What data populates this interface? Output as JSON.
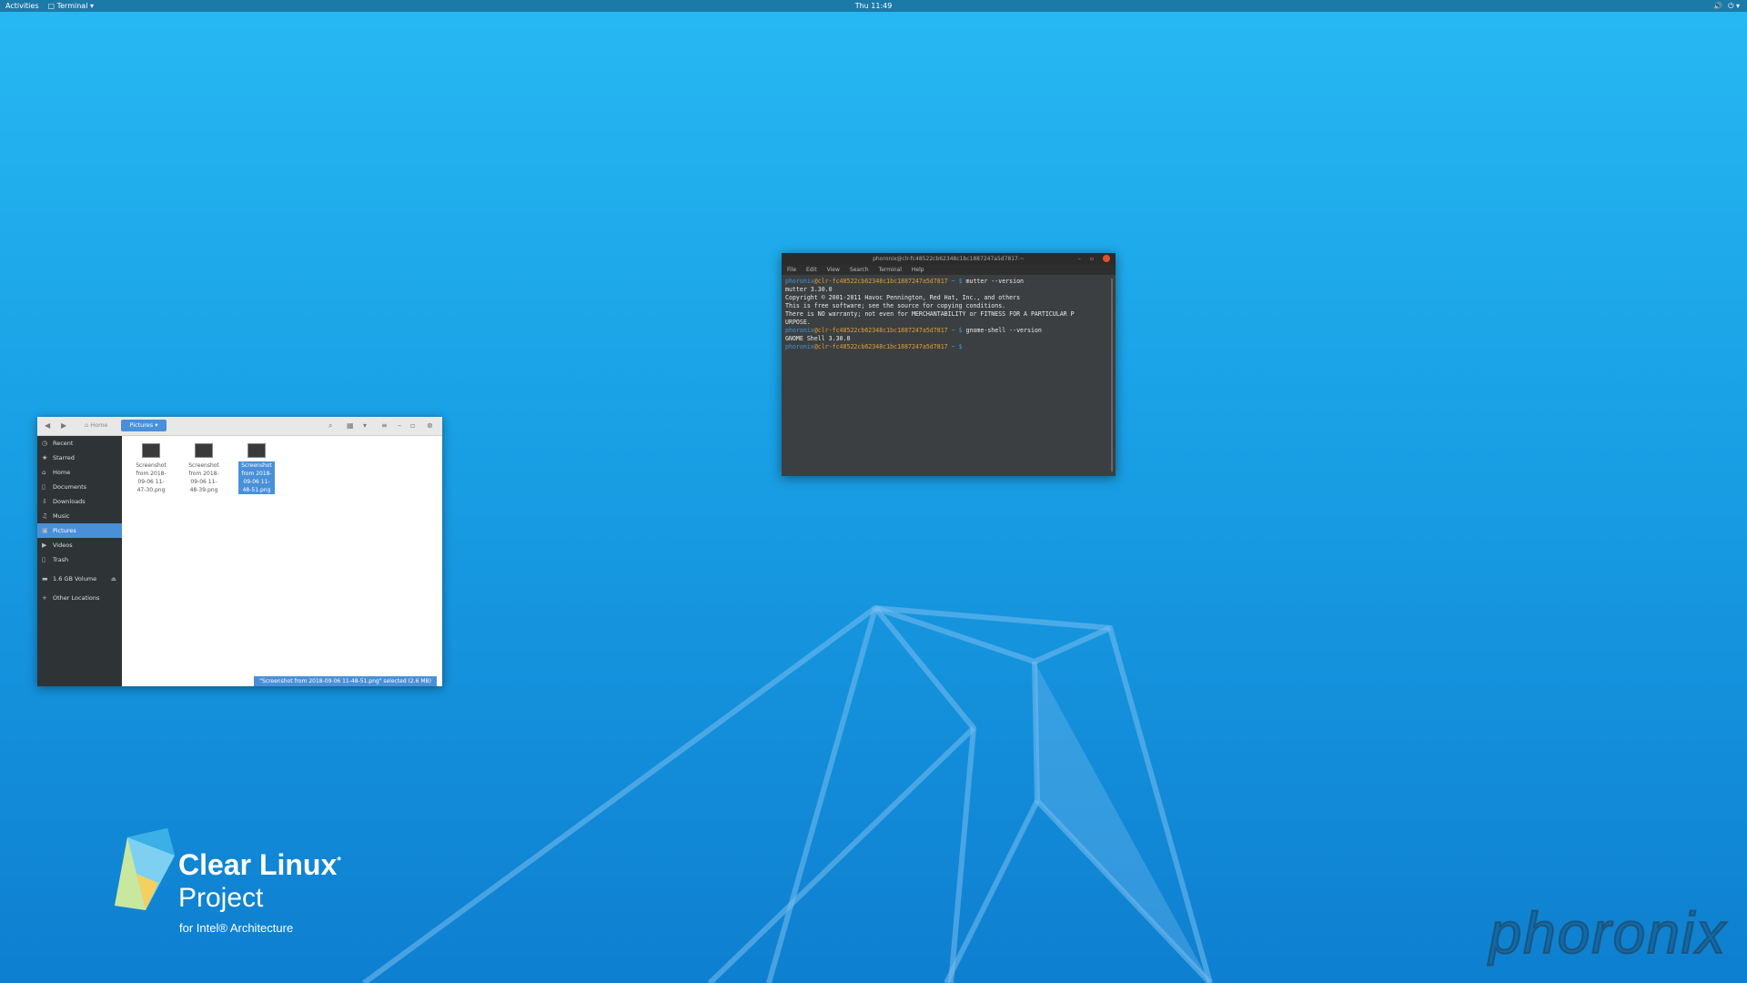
{
  "topbar": {
    "activities": "Activities",
    "app_menu": "Terminal",
    "clock": "Thu 11:49"
  },
  "files": {
    "home_crumb": "Home",
    "current_folder": "Pictures",
    "sidebar": [
      {
        "label": "Recent",
        "icon": "clock-icon"
      },
      {
        "label": "Starred",
        "icon": "star-icon"
      },
      {
        "label": "Home",
        "icon": "home-icon"
      },
      {
        "label": "Documents",
        "icon": "document-icon"
      },
      {
        "label": "Downloads",
        "icon": "download-icon"
      },
      {
        "label": "Music",
        "icon": "music-icon"
      },
      {
        "label": "Pictures",
        "icon": "picture-icon",
        "selected": true
      },
      {
        "label": "Videos",
        "icon": "video-icon"
      },
      {
        "label": "Trash",
        "icon": "trash-icon"
      }
    ],
    "volume": "1.6 GB Volume",
    "other_locations": "Other Locations",
    "files": [
      {
        "line1": "Screenshot",
        "line2": "from 2018-",
        "line3": "09-06 11-",
        "line4": "47-30.png"
      },
      {
        "line1": "Screenshot",
        "line2": "from 2018-",
        "line3": "09-06 11-",
        "line4": "48-39.png"
      },
      {
        "line1": "Screenshot",
        "line2": "from 2018-",
        "line3": "09-06 11-",
        "line4": "48-51.png",
        "selected": true
      }
    ],
    "status": "\"Screenshot from 2018-09-06 11-48-51.png\" selected (2.6 MB)"
  },
  "terminal": {
    "title": "phoronix@clr-fc48522cb62348c1bc1887247a5d7817:~",
    "menu": [
      "File",
      "Edit",
      "View",
      "Search",
      "Terminal",
      "Help"
    ],
    "prompt_user": "phoronix",
    "prompt_host": "@clr-fc48522cb62348c1bc1887247a5d7817",
    "prompt_tail": " ~ $ ",
    "cmd1": "mutter --version",
    "out1": "mutter 3.30.0\nCopyright © 2001-2011 Havoc Pennington, Red Hat, Inc., and others\nThis is free software; see the source for copying conditions.\nThere is NO warranty; not even for MERCHANTABILITY or FITNESS FOR A PARTICULAR P\nURPOSE.",
    "cmd2": "gnome-shell --version",
    "out2": "GNOME Shell 3.30.0"
  },
  "branding": {
    "clear_linux": "Clear Linux",
    "reg": "*",
    "project": "Project",
    "arch": "for Intel® Architecture",
    "watermark": "phoronix"
  }
}
